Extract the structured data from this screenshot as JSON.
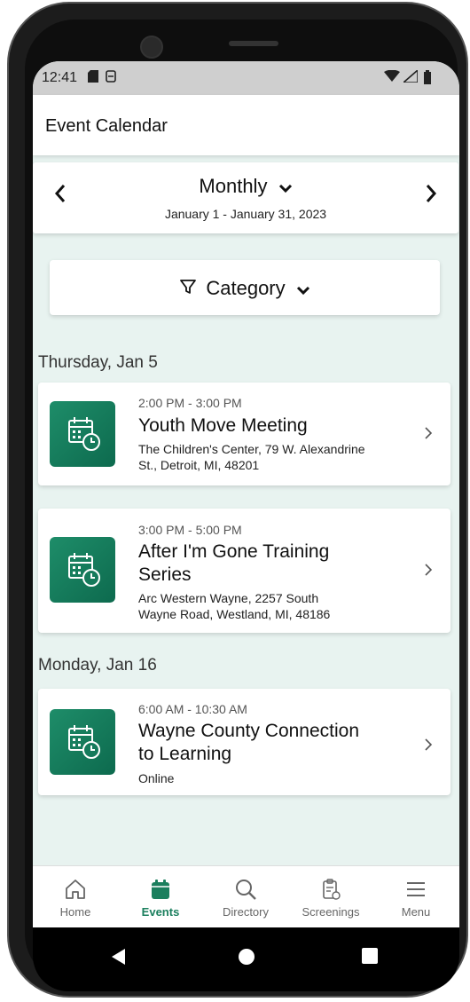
{
  "status_bar": {
    "time": "12:41"
  },
  "app_bar": {
    "title": "Event Calendar"
  },
  "period": {
    "mode": "Monthly",
    "range": "January 1 - January 31, 2023",
    "prev_icon": "chevron-left-icon",
    "next_icon": "chevron-right-icon"
  },
  "filter": {
    "label": "Category",
    "icon": "filter-icon"
  },
  "days": [
    {
      "label": "Thursday, Jan 5",
      "events": [
        {
          "time": "2:00 PM - 3:00 PM",
          "title": "Youth Move Meeting",
          "location": "The Children's Center, 79 W. Alexandrine St., Detroit, MI, 48201"
        },
        {
          "time": "3:00 PM - 5:00 PM",
          "title": "After I'm Gone Training Series",
          "location": "Arc Western Wayne, 2257 South Wayne Road, Westland, MI, 48186"
        }
      ]
    },
    {
      "label": "Monday, Jan 16",
      "events": [
        {
          "time": "6:00 AM - 10:30 AM",
          "title": "Wayne County Connection to Learning",
          "location": "Online"
        }
      ]
    }
  ],
  "bottom_nav": {
    "items": [
      {
        "label": "Home",
        "icon": "home-icon"
      },
      {
        "label": "Events",
        "icon": "calendar-icon"
      },
      {
        "label": "Directory",
        "icon": "search-icon"
      },
      {
        "label": "Screenings",
        "icon": "clipboard-icon"
      },
      {
        "label": "Menu",
        "icon": "menu-icon"
      }
    ],
    "active": "Events"
  },
  "colors": {
    "accent": "#1b7f5e",
    "background": "#e8f3f0"
  }
}
